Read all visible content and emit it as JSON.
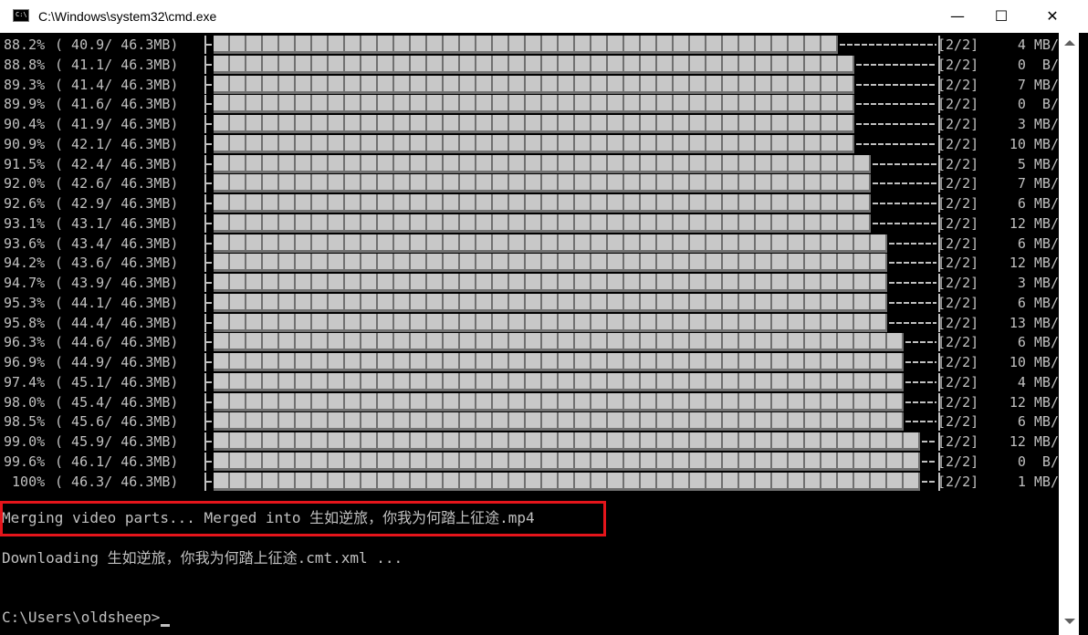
{
  "window": {
    "title": "C:\\Windows\\system32\\cmd.exe",
    "icon": "cmd-icon",
    "icon_glyph": "C:\\",
    "minimize_glyph": "—",
    "maximize_glyph": "☐",
    "close_glyph": "✕"
  },
  "progress_rows": [
    {
      "pct": "88.2%",
      "size": "( 40.9/ 46.3MB)",
      "progress": 88.2,
      "parts": "[2/2]",
      "speed": "4 MB/"
    },
    {
      "pct": "88.8%",
      "size": "( 41.1/ 46.3MB)",
      "progress": 88.8,
      "parts": "[2/2]",
      "speed": "0  B/"
    },
    {
      "pct": "89.3%",
      "size": "( 41.4/ 46.3MB)",
      "progress": 89.3,
      "parts": "[2/2]",
      "speed": "7 MB/"
    },
    {
      "pct": "89.9%",
      "size": "( 41.6/ 46.3MB)",
      "progress": 89.9,
      "parts": "[2/2]",
      "speed": "0  B/"
    },
    {
      "pct": "90.4%",
      "size": "( 41.9/ 46.3MB)",
      "progress": 90.4,
      "parts": "[2/2]",
      "speed": "3 MB/"
    },
    {
      "pct": "90.9%",
      "size": "( 42.1/ 46.3MB)",
      "progress": 90.9,
      "parts": "[2/2]",
      "speed": "10 MB/"
    },
    {
      "pct": "91.5%",
      "size": "( 42.4/ 46.3MB)",
      "progress": 91.5,
      "parts": "[2/2]",
      "speed": "5 MB/"
    },
    {
      "pct": "92.0%",
      "size": "( 42.6/ 46.3MB)",
      "progress": 92.0,
      "parts": "[2/2]",
      "speed": "7 MB/"
    },
    {
      "pct": "92.6%",
      "size": "( 42.9/ 46.3MB)",
      "progress": 92.6,
      "parts": "[2/2]",
      "speed": "6 MB/"
    },
    {
      "pct": "93.1%",
      "size": "( 43.1/ 46.3MB)",
      "progress": 93.1,
      "parts": "[2/2]",
      "speed": "12 MB/"
    },
    {
      "pct": "93.6%",
      "size": "( 43.4/ 46.3MB)",
      "progress": 93.6,
      "parts": "[2/2]",
      "speed": "6 MB/"
    },
    {
      "pct": "94.2%",
      "size": "( 43.6/ 46.3MB)",
      "progress": 94.2,
      "parts": "[2/2]",
      "speed": "12 MB/"
    },
    {
      "pct": "94.7%",
      "size": "( 43.9/ 46.3MB)",
      "progress": 94.7,
      "parts": "[2/2]",
      "speed": "3 MB/"
    },
    {
      "pct": "95.3%",
      "size": "( 44.1/ 46.3MB)",
      "progress": 95.3,
      "parts": "[2/2]",
      "speed": "6 MB/"
    },
    {
      "pct": "95.8%",
      "size": "( 44.4/ 46.3MB)",
      "progress": 95.8,
      "parts": "[2/2]",
      "speed": "13 MB/"
    },
    {
      "pct": "96.3%",
      "size": "( 44.6/ 46.3MB)",
      "progress": 96.3,
      "parts": "[2/2]",
      "speed": "6 MB/"
    },
    {
      "pct": "96.9%",
      "size": "( 44.9/ 46.3MB)",
      "progress": 96.9,
      "parts": "[2/2]",
      "speed": "10 MB/"
    },
    {
      "pct": "97.4%",
      "size": "( 45.1/ 46.3MB)",
      "progress": 97.4,
      "parts": "[2/2]",
      "speed": "4 MB/"
    },
    {
      "pct": "98.0%",
      "size": "( 45.4/ 46.3MB)",
      "progress": 98.0,
      "parts": "[2/2]",
      "speed": "12 MB/"
    },
    {
      "pct": "98.5%",
      "size": "( 45.6/ 46.3MB)",
      "progress": 98.5,
      "parts": "[2/2]",
      "speed": "6 MB/"
    },
    {
      "pct": "99.0%",
      "size": "( 45.9/ 46.3MB)",
      "progress": 99.0,
      "parts": "[2/2]",
      "speed": "12 MB/"
    },
    {
      "pct": "99.6%",
      "size": "( 46.1/ 46.3MB)",
      "progress": 99.6,
      "parts": "[2/2]",
      "speed": "0  B/"
    },
    {
      "pct": " 100%",
      "size": "( 46.3/ 46.3MB)",
      "progress": 100,
      "parts": "[2/2]",
      "speed": "1 MB/"
    }
  ],
  "messages": {
    "merge": "Merging video parts... Merged into 生如逆旅，你我为何踏上征途.mp4",
    "downloading": "Downloading 生如逆旅，你我为何踏上征途.cmt.xml ...",
    "prompt": "C:\\Users\\oldsheep>"
  },
  "colors": {
    "console_bg": "#000000",
    "console_fg": "#c0c0c0",
    "highlight_border": "#e5151b"
  }
}
